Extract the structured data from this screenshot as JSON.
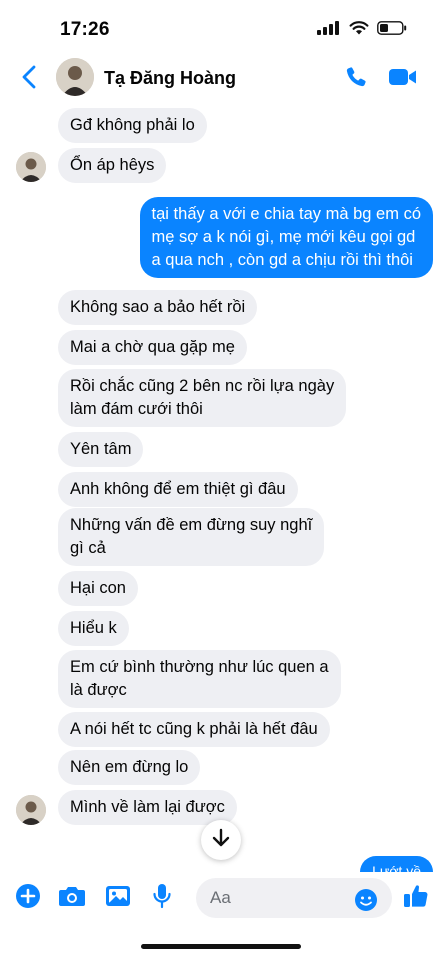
{
  "status_bar": {
    "time": "17:26"
  },
  "header": {
    "contact_name": "Tạ Đăng Hoàng"
  },
  "messages": [
    {
      "side": "in",
      "text": "Gđ không phải lo",
      "avatar": false
    },
    {
      "side": "in",
      "text": "Ổn áp hêys",
      "avatar": true
    },
    {
      "side": "out",
      "text": "tại thấy a với e chia tay mà bg em có\nmẹ sợ a k nói gì, mẹ mới kêu gọi gd\na qua nch , còn gd a chịu rồi thì thôi"
    },
    {
      "side": "in",
      "text": "Không sao a bảo hết rồi",
      "avatar": false
    },
    {
      "side": "in",
      "text": "Mai a chờ qua gặp mẹ",
      "avatar": false
    },
    {
      "side": "in",
      "text": "Rồi chắc cũng 2 bên nc rồi lựa ngày\nlàm đám cưới thôi",
      "avatar": false
    },
    {
      "side": "in",
      "text": "Yên tâm",
      "avatar": false
    },
    {
      "side": "in",
      "text": "Anh không để em thiệt gì đâu",
      "avatar": false
    },
    {
      "side": "in",
      "text": "Những vấn đề em đừng suy nghĩ\ngì cả",
      "avatar": false
    },
    {
      "side": "in",
      "text": "Hại con",
      "avatar": false
    },
    {
      "side": "in",
      "text": "Hiểu k",
      "avatar": false
    },
    {
      "side": "in",
      "text": "Em cứ bình thường như lúc quen a\nlà được",
      "avatar": false
    },
    {
      "side": "in",
      "text": "A nói hết tc cũng k phải là hết đâu",
      "avatar": false
    },
    {
      "side": "in",
      "text": "Nên em đừng lo",
      "avatar": false
    },
    {
      "side": "in",
      "text": "Mình về làm lại được",
      "avatar": true
    },
    {
      "side": "out",
      "text": "Lướt về",
      "partial": true
    }
  ],
  "composer": {
    "placeholder": "Aa"
  },
  "icons": {
    "back": "chevron-left-icon",
    "call": "phone-icon",
    "video": "video-camera-icon",
    "add": "plus-circle-icon",
    "camera": "camera-icon",
    "gallery": "image-icon",
    "mic": "microphone-icon",
    "emoji": "emoji-icon",
    "like": "thumbs-up-icon",
    "scroll_down": "arrow-down-icon"
  },
  "colors": {
    "accent": "#0a84ff",
    "incoming_bubble": "#eeeff3",
    "text": "#050505"
  }
}
